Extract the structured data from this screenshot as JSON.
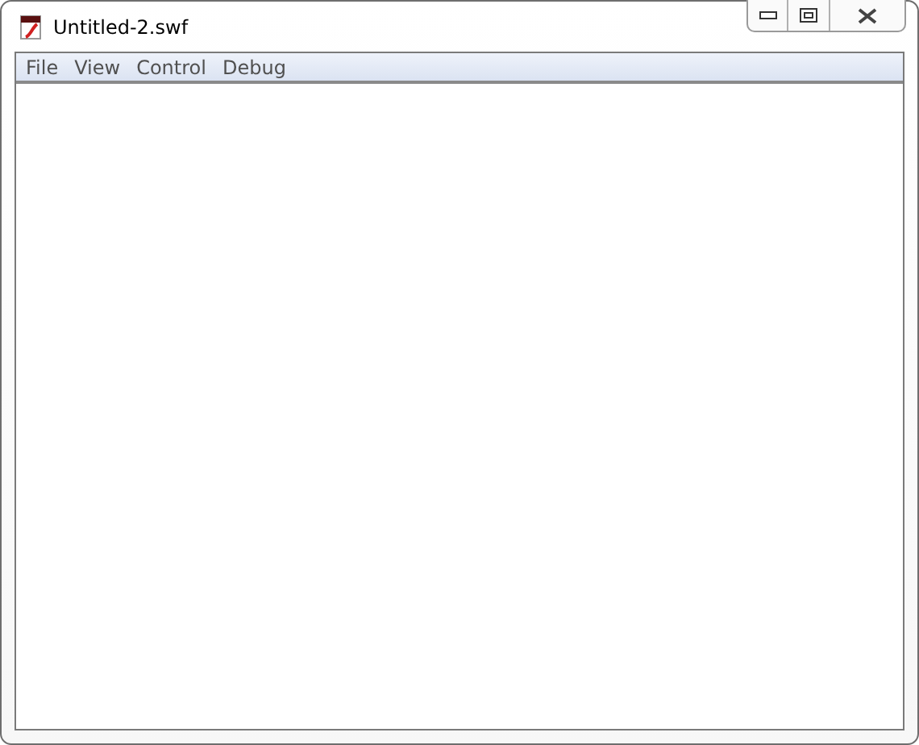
{
  "window": {
    "title": "Untitled-2.swf"
  },
  "menu": [
    "File",
    "View",
    "Control",
    "Debug"
  ]
}
